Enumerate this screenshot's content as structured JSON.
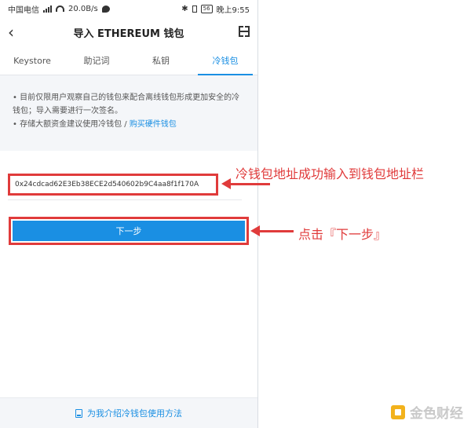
{
  "status_bar": {
    "carrier": "中国电信",
    "signal": "4G",
    "speed": "20.0B/s",
    "battery": "56",
    "time": "晚上9:55"
  },
  "header": {
    "back_icon": "chevron-left-icon",
    "title": "导入 ETHEREUM 钱包",
    "scan_icon": "scan-icon"
  },
  "tabs": [
    {
      "label": "Keystore",
      "active": false
    },
    {
      "label": "助记词",
      "active": false
    },
    {
      "label": "私钥",
      "active": false
    },
    {
      "label": "冷钱包",
      "active": true
    }
  ],
  "notice": {
    "line1": "• 目前仅限用户观察自己的钱包来配合离线钱包形成更加安全的冷钱包；导入需要进行一次签名。",
    "line2_prefix": "• 存储大额资金建议使用冷钱包 / ",
    "line2_link": "购买硬件钱包"
  },
  "address_input": {
    "value": "0x24cdcad62E3Eb38ECE2d540602b9C4aa8f1f170A"
  },
  "next_button": {
    "label": "下一步"
  },
  "bottom_link": {
    "icon": "book-icon",
    "label": "为我介绍冷钱包使用方法"
  },
  "annotations": {
    "address_note": "冷钱包地址成功输入到钱包地址栏",
    "next_note": "点击『下一步』"
  },
  "watermark": {
    "text": "金色财经"
  },
  "colors": {
    "accent": "#1a8fe3",
    "annotation_red": "#e03b3b"
  }
}
